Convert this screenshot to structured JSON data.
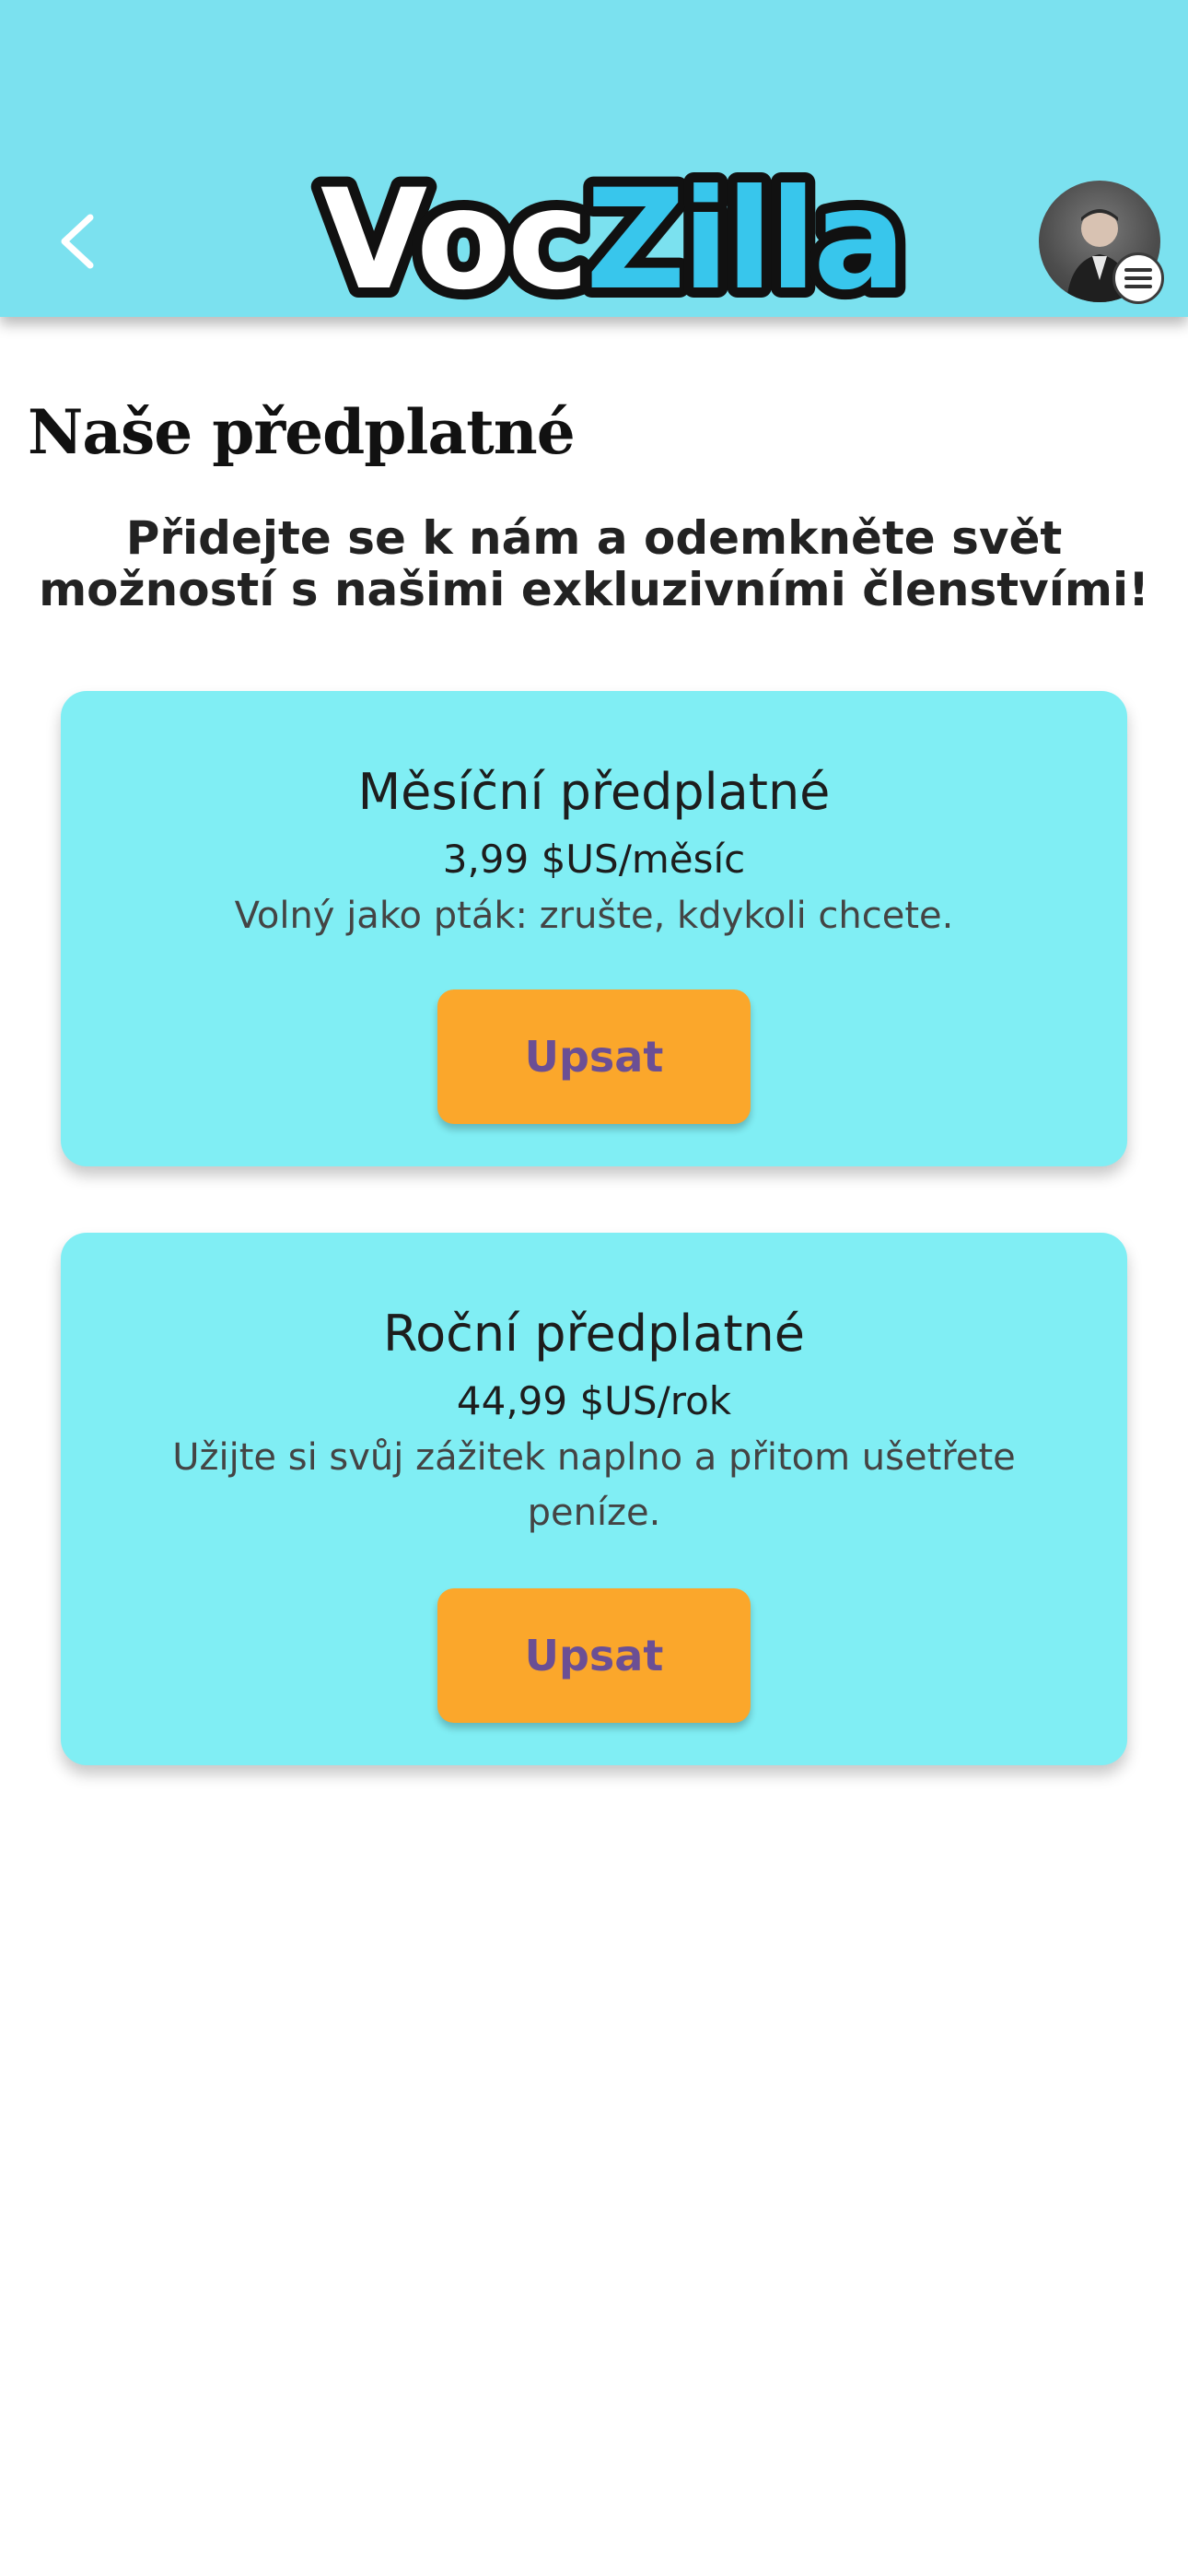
{
  "header": {
    "logo_part1": "Voc",
    "logo_part2": "Zilla",
    "back_icon": "chevron-left-icon",
    "menu_icon": "hamburger-menu-icon"
  },
  "page": {
    "title": "Naše předplatné",
    "subtitle": "Přidejte se k nám a odemkněte svět možností s našimi exkluzivními členstvími!"
  },
  "plans": [
    {
      "title": "Měsíční předplatné",
      "price": "3,99 $US/měsíc",
      "description": "Volný jako pták: zrušte, kdykoli chcete.",
      "button": "Upsat"
    },
    {
      "title": "Roční předplatné",
      "price": "44,99 $US/rok",
      "description": "Užijte si svůj zážitek naplno a přitom ušetřete peníze.",
      "button": "Upsat"
    }
  ],
  "colors": {
    "header_bg": "#7be1ef",
    "card_bg": "#80eef4",
    "button_bg": "#fba72b",
    "button_text": "#6b4f94",
    "logo_accent": "#38c6ec"
  }
}
